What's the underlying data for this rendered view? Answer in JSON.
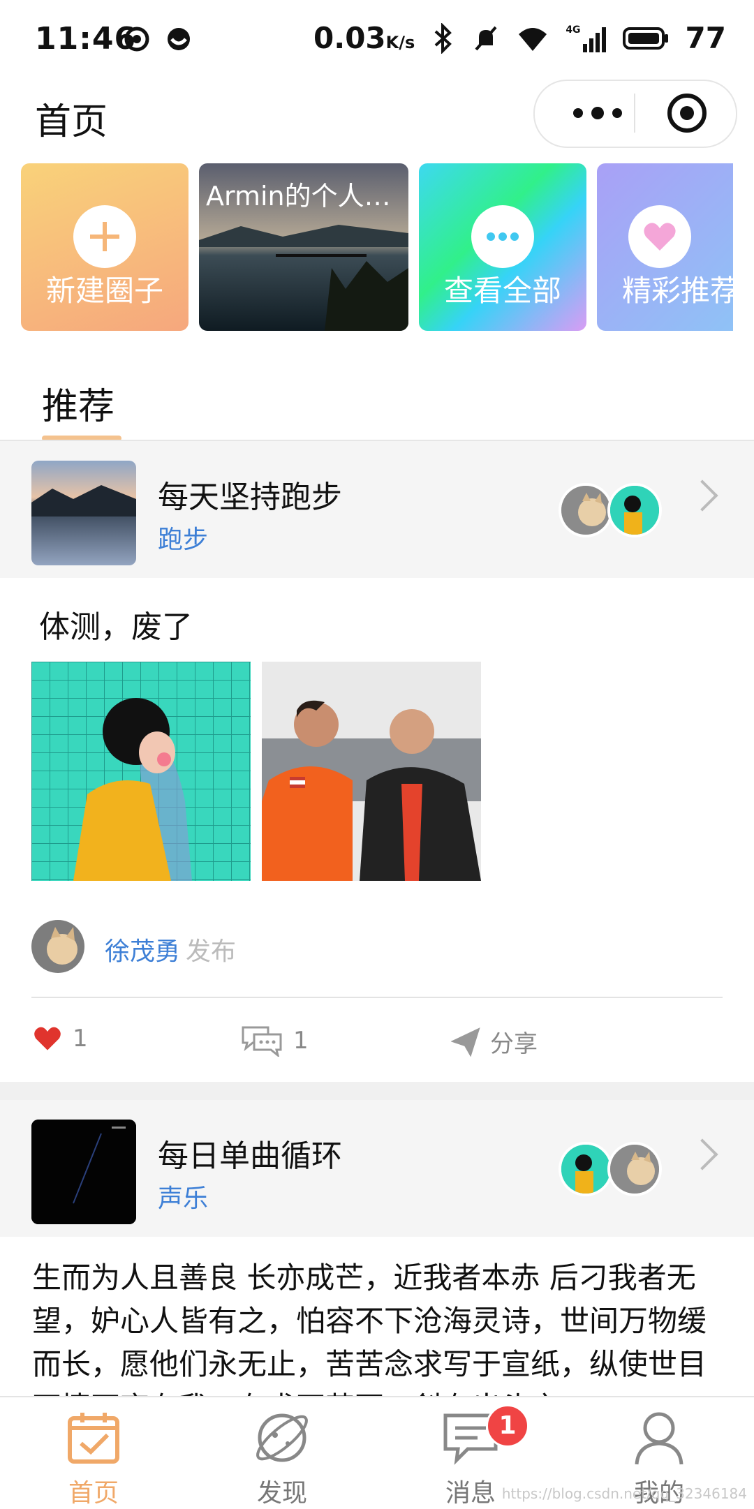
{
  "status_bar": {
    "time": "11:46",
    "speed": "0.03",
    "speed_unit": "K/s",
    "network": "4G",
    "battery": "77"
  },
  "header": {
    "title": "首页"
  },
  "cards": [
    {
      "label": "新建圈子",
      "icon": "plus-icon"
    },
    {
      "label": "Armin的个人…",
      "icon": "lake-photo"
    },
    {
      "label": "查看全部",
      "icon": "more-dots-icon"
    },
    {
      "label": "精彩推荐",
      "icon": "heart-icon"
    }
  ],
  "tabs": {
    "recommend": "推荐"
  },
  "posts": [
    {
      "group_name": "每天坚持跑步",
      "group_category": "跑步",
      "text": "体测，废了",
      "author": "徐茂勇",
      "author_action": "发布",
      "likes": "1",
      "comments": "1",
      "share_label": "分享"
    },
    {
      "group_name": "每日单曲循环",
      "group_category": "声乐",
      "text": "生而为人且善良 长亦成芒，近我者本赤 后刁我者无望，妒心人皆有之，怕容不下沧海灵诗，世间万物缓而长，愿他们永无止，苦苦念求写于宣纸，纵使世目不情不齐有我，有求不苦否，斜有出头之"
    }
  ],
  "tabbar": {
    "items": [
      {
        "label": "首页",
        "icon": "calendar-check-icon"
      },
      {
        "label": "发现",
        "icon": "planet-icon"
      },
      {
        "label": "消息",
        "icon": "chat-icon"
      },
      {
        "label": "我的",
        "icon": "user-icon"
      }
    ],
    "message_badge": "1"
  },
  "watermark": "https://blog.csdn.net/qq_32346184",
  "colors": {
    "accent": "#f0a868",
    "link": "#3d7fd6",
    "like": "#e0342d",
    "badge": "#f04444"
  }
}
